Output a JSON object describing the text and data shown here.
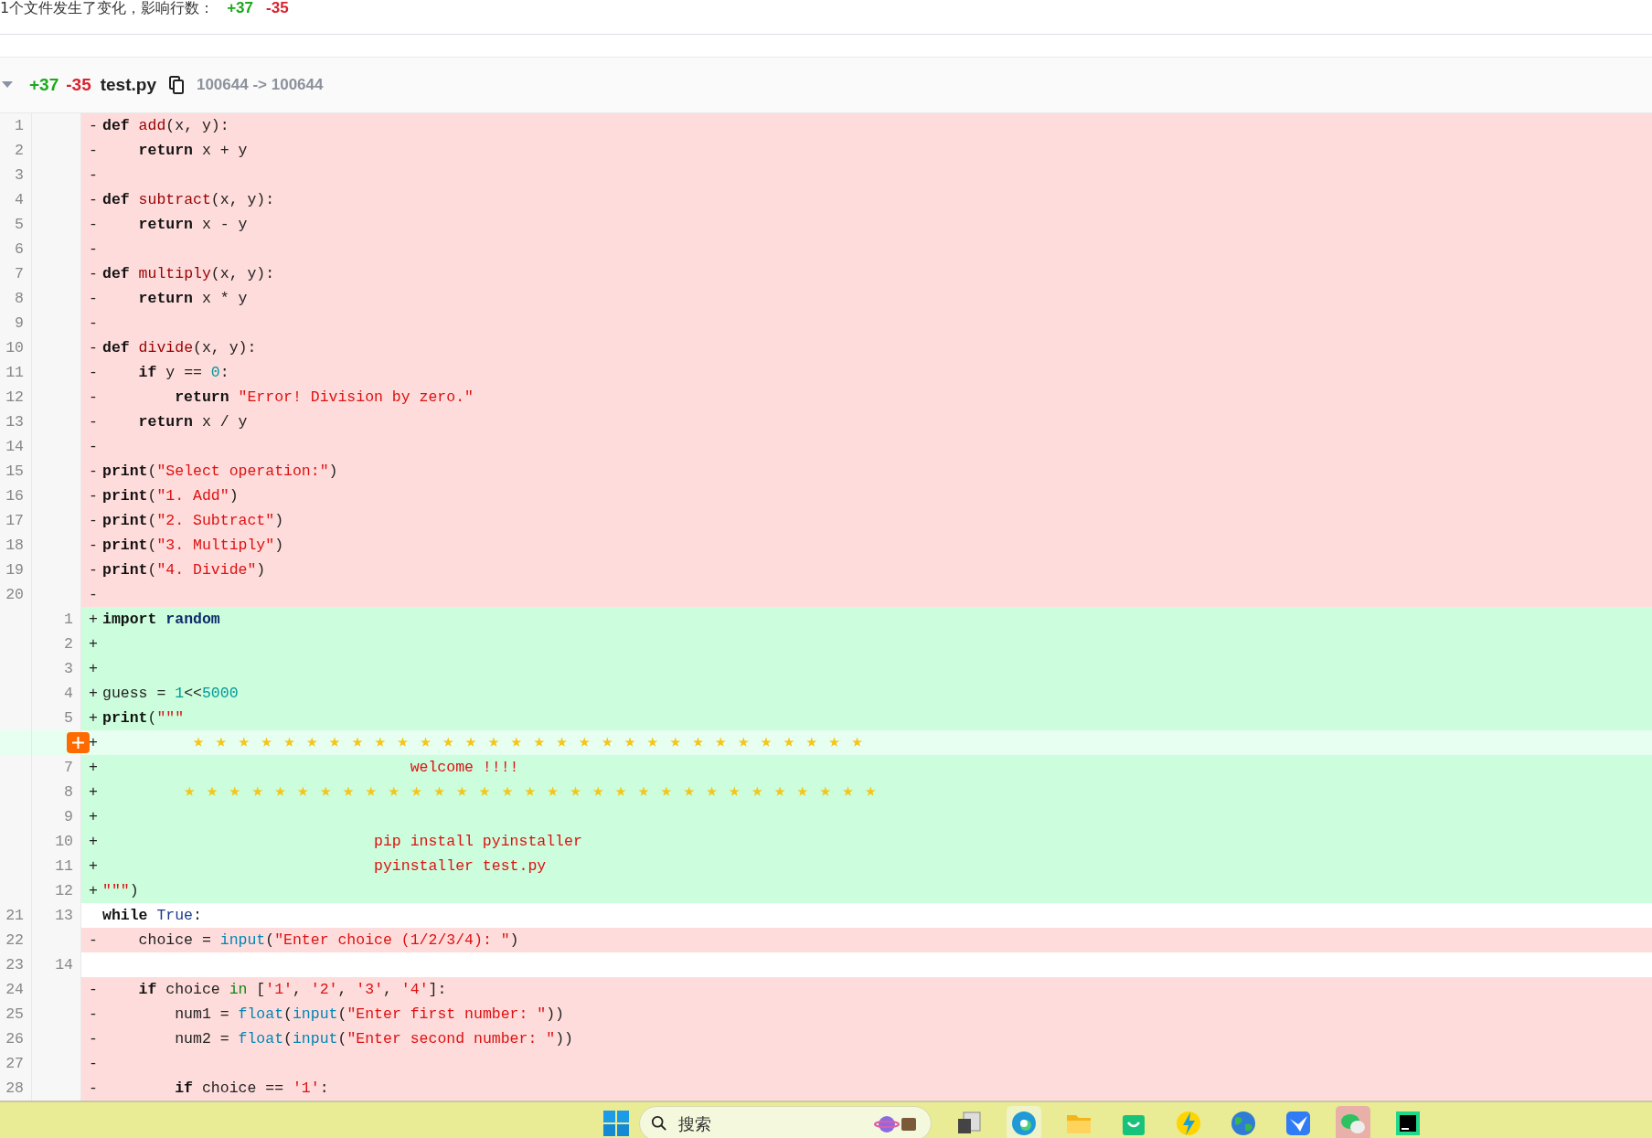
{
  "summary": {
    "text": "1个文件发生了变化，影响行数：",
    "added": "+37",
    "removed": "-35"
  },
  "file": {
    "expanded": true,
    "added": "+37",
    "removed": "-35",
    "name": "test.py",
    "mode": "100644 -> 100644"
  },
  "lines": [
    {
      "kind": "del",
      "old": "1",
      "sign": "-",
      "tokens": [
        {
          "kind": "keyword",
          "text": "def"
        },
        {
          "kind": "function",
          "text": " add"
        },
        {
          "kind": "plain",
          "text": "(x, y):"
        }
      ]
    },
    {
      "kind": "del",
      "old": "2",
      "sign": "-",
      "tokens": [
        {
          "kind": "keyword",
          "text": "    return"
        },
        {
          "kind": "plain",
          "text": " x + y"
        }
      ]
    },
    {
      "kind": "del",
      "old": "3",
      "sign": "-"
    },
    {
      "kind": "del",
      "old": "4",
      "sign": "-",
      "tokens": [
        {
          "kind": "keyword",
          "text": "def"
        },
        {
          "kind": "function",
          "text": " subtract"
        },
        {
          "kind": "plain",
          "text": "(x, y):"
        }
      ]
    },
    {
      "kind": "del",
      "old": "5",
      "sign": "-",
      "tokens": [
        {
          "kind": "keyword",
          "text": "    return"
        },
        {
          "kind": "plain",
          "text": " x - y"
        }
      ]
    },
    {
      "kind": "del",
      "old": "6",
      "sign": "-"
    },
    {
      "kind": "del",
      "old": "7",
      "sign": "-",
      "tokens": [
        {
          "kind": "keyword",
          "text": "def"
        },
        {
          "kind": "function",
          "text": " multiply"
        },
        {
          "kind": "plain",
          "text": "(x, y):"
        }
      ]
    },
    {
      "kind": "del",
      "old": "8",
      "sign": "-",
      "tokens": [
        {
          "kind": "keyword",
          "text": "    return"
        },
        {
          "kind": "plain",
          "text": " x * y"
        }
      ]
    },
    {
      "kind": "del",
      "old": "9",
      "sign": "-"
    },
    {
      "kind": "del",
      "old": "10",
      "sign": "-",
      "tokens": [
        {
          "kind": "keyword",
          "text": "def"
        },
        {
          "kind": "function",
          "text": " divide"
        },
        {
          "kind": "plain",
          "text": "(x, y):"
        }
      ]
    },
    {
      "kind": "del",
      "old": "11",
      "sign": "-",
      "tokens": [
        {
          "kind": "keyword",
          "text": "    if"
        },
        {
          "kind": "plain",
          "text": " y == "
        },
        {
          "kind": "number",
          "text": "0"
        },
        {
          "kind": "plain",
          "text": ":"
        }
      ]
    },
    {
      "kind": "del",
      "old": "12",
      "sign": "-",
      "tokens": [
        {
          "kind": "keyword",
          "text": "        return"
        },
        {
          "kind": "string",
          "text": " \"Error! Division by zero.\""
        }
      ]
    },
    {
      "kind": "del",
      "old": "13",
      "sign": "-",
      "tokens": [
        {
          "kind": "keyword",
          "text": "    return"
        },
        {
          "kind": "plain",
          "text": " x / y"
        }
      ]
    },
    {
      "kind": "del",
      "old": "14",
      "sign": "-"
    },
    {
      "kind": "del",
      "old": "15",
      "sign": "-",
      "tokens": [
        {
          "kind": "keyword",
          "text": "print"
        },
        {
          "kind": "plain",
          "text": "("
        },
        {
          "kind": "string",
          "text": "\"Select operation:\""
        },
        {
          "kind": "plain",
          "text": ")"
        }
      ]
    },
    {
      "kind": "del",
      "old": "16",
      "sign": "-",
      "tokens": [
        {
          "kind": "keyword",
          "text": "print"
        },
        {
          "kind": "plain",
          "text": "("
        },
        {
          "kind": "string",
          "text": "\"1. Add\""
        },
        {
          "kind": "plain",
          "text": ")"
        }
      ]
    },
    {
      "kind": "del",
      "old": "17",
      "sign": "-",
      "tokens": [
        {
          "kind": "keyword",
          "text": "print"
        },
        {
          "kind": "plain",
          "text": "("
        },
        {
          "kind": "string",
          "text": "\"2. Subtract\""
        },
        {
          "kind": "plain",
          "text": ")"
        }
      ]
    },
    {
      "kind": "del",
      "old": "18",
      "sign": "-",
      "tokens": [
        {
          "kind": "keyword",
          "text": "print"
        },
        {
          "kind": "plain",
          "text": "("
        },
        {
          "kind": "string",
          "text": "\"3. Multiply\""
        },
        {
          "kind": "plain",
          "text": ")"
        }
      ]
    },
    {
      "kind": "del",
      "old": "19",
      "sign": "-",
      "tokens": [
        {
          "kind": "keyword",
          "text": "print"
        },
        {
          "kind": "plain",
          "text": "("
        },
        {
          "kind": "string",
          "text": "\"4. Divide\""
        },
        {
          "kind": "plain",
          "text": ")"
        }
      ]
    },
    {
      "kind": "del",
      "old": "20",
      "sign": "-"
    },
    {
      "kind": "add",
      "new": "1",
      "sign": "+",
      "tokens": [
        {
          "kind": "keyword",
          "text": "import"
        },
        {
          "kind": "module",
          "text": " random"
        }
      ]
    },
    {
      "kind": "add",
      "new": "2",
      "sign": "+"
    },
    {
      "kind": "add",
      "new": "3",
      "sign": "+"
    },
    {
      "kind": "add",
      "new": "4",
      "sign": "+",
      "tokens": [
        {
          "kind": "plain",
          "text": "guess = "
        },
        {
          "kind": "number",
          "text": "1"
        },
        {
          "kind": "plain",
          "text": "<<"
        },
        {
          "kind": "number",
          "text": "5000"
        }
      ]
    },
    {
      "kind": "add",
      "new": "5",
      "sign": "+",
      "tokens": [
        {
          "kind": "keyword",
          "text": "print"
        },
        {
          "kind": "plain",
          "text": "("
        },
        {
          "kind": "string",
          "text": "\"\"\""
        }
      ]
    },
    {
      "kind": "add",
      "sign": "+",
      "hovered": true,
      "tokens": [
        {
          "kind": "star",
          "text": "          ★★★★★★★★★★★★★★★★★★★★★★★★★★★★★★"
        }
      ]
    },
    {
      "kind": "add",
      "new": "7",
      "sign": "+",
      "tokens": [
        {
          "kind": "string",
          "text": "                                  welcome !!!!"
        }
      ]
    },
    {
      "kind": "add",
      "new": "8",
      "sign": "+",
      "tokens": [
        {
          "kind": "star",
          "text": "         ★★★★★★★★★★★★★★★★★★★★★★★★★★★★★★★"
        }
      ]
    },
    {
      "kind": "add",
      "new": "9",
      "sign": "+"
    },
    {
      "kind": "add",
      "new": "10",
      "sign": "+",
      "tokens": [
        {
          "kind": "string",
          "text": "                              pip install pyinstaller"
        }
      ]
    },
    {
      "kind": "add",
      "new": "11",
      "sign": "+",
      "tokens": [
        {
          "kind": "string",
          "text": "                              pyinstaller test.py"
        }
      ]
    },
    {
      "kind": "add",
      "new": "12",
      "sign": "+",
      "tokens": [
        {
          "kind": "string",
          "text": "\"\"\""
        },
        {
          "kind": "plain",
          "text": ")"
        }
      ]
    },
    {
      "kind": "ctx",
      "old": "21",
      "new": "13",
      "tokens": [
        {
          "kind": "keyword",
          "text": "while"
        },
        {
          "kind": "constant",
          "text": " True"
        },
        {
          "kind": "plain",
          "text": ":"
        }
      ]
    },
    {
      "kind": "del",
      "old": "22",
      "sign": "-",
      "tokens": [
        {
          "kind": "plain",
          "text": "    choice = "
        },
        {
          "kind": "builtin",
          "text": "input"
        },
        {
          "kind": "plain",
          "text": "("
        },
        {
          "kind": "string",
          "text": "\"Enter choice (1/2/3/4): \""
        },
        {
          "kind": "plain",
          "text": ")"
        }
      ]
    },
    {
      "kind": "ctx",
      "old": "23",
      "new": "14"
    },
    {
      "kind": "del",
      "old": "24",
      "sign": "-",
      "tokens": [
        {
          "kind": "keyword",
          "text": "    if"
        },
        {
          "kind": "plain",
          "text": " choice "
        },
        {
          "kind": "operator",
          "text": "in"
        },
        {
          "kind": "plain",
          "text": " ["
        },
        {
          "kind": "string",
          "text": "'1'"
        },
        {
          "kind": "plain",
          "text": ", "
        },
        {
          "kind": "string",
          "text": "'2'"
        },
        {
          "kind": "plain",
          "text": ", "
        },
        {
          "kind": "string",
          "text": "'3'"
        },
        {
          "kind": "plain",
          "text": ", "
        },
        {
          "kind": "string",
          "text": "'4'"
        },
        {
          "kind": "plain",
          "text": "]:"
        }
      ]
    },
    {
      "kind": "del",
      "old": "25",
      "sign": "-",
      "tokens": [
        {
          "kind": "plain",
          "text": "        num1 = "
        },
        {
          "kind": "builtin",
          "text": "float"
        },
        {
          "kind": "plain",
          "text": "("
        },
        {
          "kind": "builtin",
          "text": "input"
        },
        {
          "kind": "plain",
          "text": "("
        },
        {
          "kind": "string",
          "text": "\"Enter first number: \""
        },
        {
          "kind": "plain",
          "text": "))"
        }
      ]
    },
    {
      "kind": "del",
      "old": "26",
      "sign": "-",
      "tokens": [
        {
          "kind": "plain",
          "text": "        num2 = "
        },
        {
          "kind": "builtin",
          "text": "float"
        },
        {
          "kind": "plain",
          "text": "("
        },
        {
          "kind": "builtin",
          "text": "input"
        },
        {
          "kind": "plain",
          "text": "("
        },
        {
          "kind": "string",
          "text": "\"Enter second number: \""
        },
        {
          "kind": "plain",
          "text": "))"
        }
      ]
    },
    {
      "kind": "del",
      "old": "27",
      "sign": "-"
    },
    {
      "kind": "del",
      "old": "28",
      "sign": "-",
      "tokens": [
        {
          "kind": "keyword",
          "text": "        if"
        },
        {
          "kind": "plain",
          "text": " choice == "
        },
        {
          "kind": "string",
          "text": "'1'"
        },
        {
          "kind": "plain",
          "text": ":"
        }
      ]
    }
  ],
  "taskbar": {
    "search": {
      "placeholder": "搜索"
    },
    "apps": [
      {
        "kind": "edge",
        "selected": true
      },
      {
        "kind": "folder",
        "selected": false
      },
      {
        "kind": "bag",
        "selected": false
      },
      {
        "kind": "bolt",
        "selected": false
      },
      {
        "kind": "globe",
        "selected": false
      },
      {
        "kind": "bird",
        "selected": false
      },
      {
        "kind": "chat",
        "selected": true
      },
      {
        "kind": "ide",
        "selected": false
      }
    ]
  }
}
